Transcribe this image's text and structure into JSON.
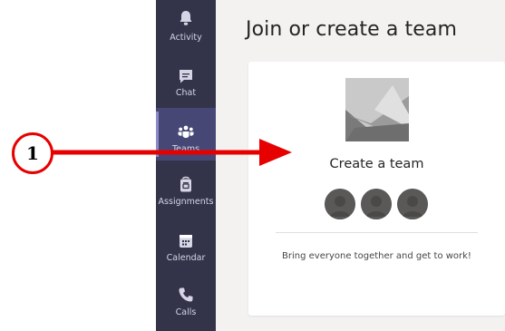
{
  "rail": {
    "items": [
      {
        "label": "Activity",
        "icon": "bell-icon",
        "active": false
      },
      {
        "label": "Chat",
        "icon": "chat-icon",
        "active": false
      },
      {
        "label": "Teams",
        "icon": "teams-icon",
        "active": true
      },
      {
        "label": "Assignments",
        "icon": "assignments-icon",
        "active": false
      },
      {
        "label": "Calendar",
        "icon": "calendar-icon",
        "active": false
      },
      {
        "label": "Calls",
        "icon": "phone-icon",
        "active": false
      }
    ]
  },
  "main": {
    "title": "Join or create a team",
    "card": {
      "title": "Create a team",
      "description": "Bring everyone together and get to work!",
      "avatar_count": 3
    }
  },
  "annotation": {
    "number": "1",
    "color": "#e60000"
  },
  "colors": {
    "rail_bg": "#33344a",
    "rail_active_bg": "#464775",
    "main_bg": "#f3f2f1",
    "card_bg": "#ffffff"
  }
}
